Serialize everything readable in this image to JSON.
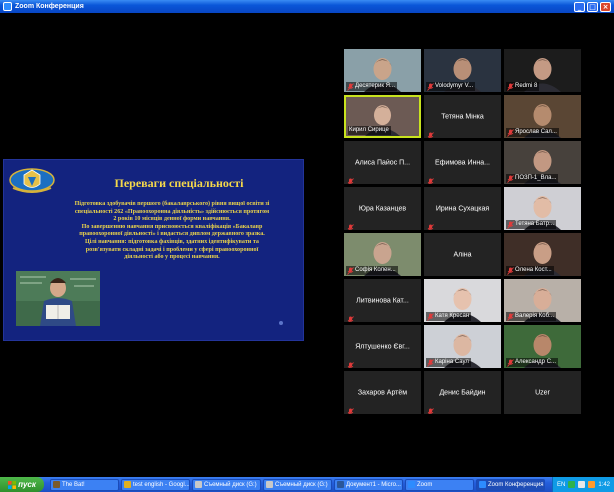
{
  "window": {
    "title": "Zoom Конференция",
    "min": "_",
    "max": "□",
    "close": "×"
  },
  "slide": {
    "title": "Переваги спеціальності",
    "lines": [
      "Підготовка здобувачів першого (бакалаврського) рівня вищої освіти зі",
      "спеціальності 262 «Правоохоронна діяльність» здійснюється протягом",
      "2 років 10 місяців денної форми навчання.",
      "По завершенню навчання присвоюється кваліфікація «Бакалавр",
      "правоохоронної діяльності» і видається диплом державного зразка.",
      "Цілі навчання: підготовка фахівців, здатних ідентифікувати та",
      "розв'язувати складні задачі і проблеми у сфері правоохоронної",
      "діяльності або у процесі навчання."
    ]
  },
  "participants": [
    {
      "name": "Десятерик Я...",
      "video": true,
      "muted": true,
      "skin": "#c9a48a",
      "bg": "#8aa0a8"
    },
    {
      "name": "Volodymyr V...",
      "video": true,
      "muted": true,
      "skin": "#b88f77",
      "bg": "#2a3340"
    },
    {
      "name": "Redmi 8",
      "video": true,
      "muted": true,
      "skin": "#c49a84",
      "bg": "#1c1c1c"
    },
    {
      "name": "Кирил Сирице",
      "video": true,
      "muted": false,
      "active": true,
      "skin": "#d4b09a",
      "bg": "#6c5a54"
    },
    {
      "name": "Тетяна Мінка",
      "video": false,
      "muted": true
    },
    {
      "name": "Ярослав Сал...",
      "video": true,
      "muted": true,
      "skin": "#b58b6e",
      "bg": "#5a4634"
    },
    {
      "name": "Алиса Пайос П...",
      "video": false,
      "muted": true
    },
    {
      "name": "Ефимова Инна...",
      "video": false,
      "muted": true
    },
    {
      "name": "ПОЗП-1_Вла...",
      "video": true,
      "muted": true,
      "skin": "#c29882",
      "bg": "#47413c"
    },
    {
      "name": "Юра Казанцев",
      "video": false,
      "muted": true
    },
    {
      "name": "Ирина Сухацкая",
      "video": false,
      "muted": true
    },
    {
      "name": "Тетяна Батр...",
      "video": true,
      "muted": true,
      "skin": "#e2bca6",
      "bg": "#cfcfd4"
    },
    {
      "name": "Софія Колен...",
      "video": true,
      "muted": true,
      "skin": "#c9a48f",
      "bg": "#7d8c6d"
    },
    {
      "name": "Аліна",
      "video": false,
      "muted": false
    },
    {
      "name": "Олена Кост...",
      "video": true,
      "muted": true,
      "skin": "#c99e86",
      "bg": "#3f2e27"
    },
    {
      "name": "Литвинова Кат...",
      "video": false,
      "muted": true
    },
    {
      "name": "Катя Кресан",
      "video": true,
      "muted": true,
      "skin": "#e6c2ae",
      "bg": "#d9d9dc"
    },
    {
      "name": "Валерія Коб...",
      "video": true,
      "muted": true,
      "skin": "#d8ae98",
      "bg": "#b8b0a8"
    },
    {
      "name": "Ялтушенко Євг...",
      "video": false,
      "muted": true
    },
    {
      "name": "Каріна Саул",
      "video": true,
      "muted": true,
      "skin": "#dcb7a2",
      "bg": "#cdd0d6"
    },
    {
      "name": "Александр С...",
      "video": true,
      "muted": true,
      "skin": "#b8876a",
      "bg": "#3e6a3a"
    },
    {
      "name": "Захаров Артём",
      "video": false,
      "muted": true
    },
    {
      "name": "Денис Байдин",
      "video": false,
      "muted": true
    },
    {
      "name": "Uzer",
      "video": false,
      "muted": false
    }
  ],
  "taskbar": {
    "start_label": "пуск",
    "tasks": [
      {
        "label": "The Bat!",
        "color": "#7a5a2a"
      },
      {
        "label": "test english - Googl...",
        "color": "#e0b020"
      },
      {
        "label": "Съемный диск (G:)",
        "color": "#c8c8c8"
      },
      {
        "label": "Съемный диск (G:)",
        "color": "#c8c8c8"
      },
      {
        "label": "Документ1 - Micro...",
        "color": "#2b579a"
      },
      {
        "label": "Zoom",
        "color": "#2d8cff"
      },
      {
        "label": "Zoom Конференция",
        "color": "#2d8cff",
        "active": true
      }
    ],
    "lang": "EN",
    "time": "1:42"
  }
}
